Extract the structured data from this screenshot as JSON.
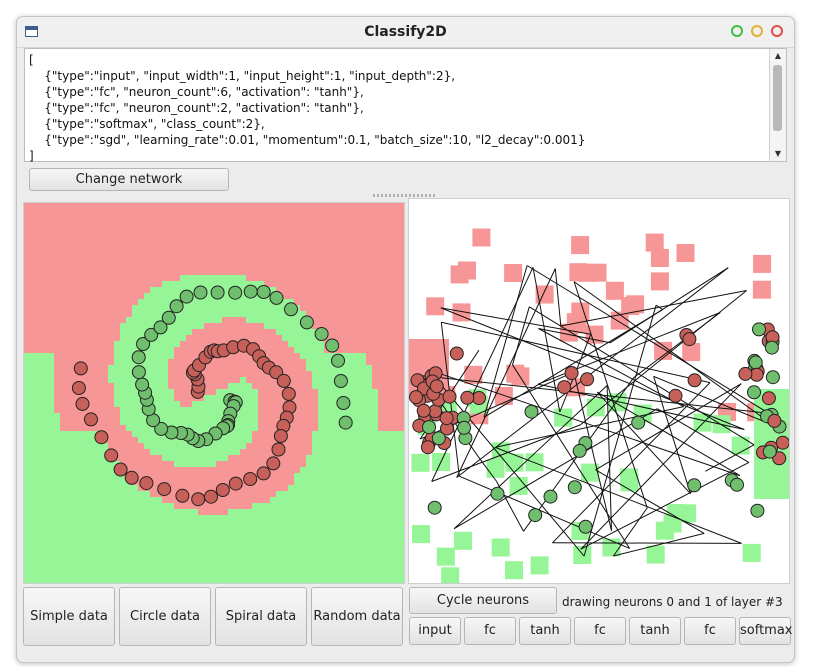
{
  "window": {
    "title": "Classify2D",
    "icon": "window-icon"
  },
  "editor": {
    "lines": [
      "[",
      "    {\"type\":\"input\", \"input_width\":1, \"input_height\":1, \"input_depth\":2},",
      "    {\"type\":\"fc\", \"neuron_count\":6, \"activation\": \"tanh\"},",
      "    {\"type\":\"fc\", \"neuron_count\":2, \"activation\": \"tanh\"},",
      "    {\"type\":\"softmax\", \"class_count\":2},",
      "    {\"type\":\"sgd\", \"learning_rate\":0.01, \"momentum\":0.1, \"batch_size\":10, \"l2_decay\":0.001}",
      "]"
    ]
  },
  "buttons": {
    "change_network": "Change network",
    "simple_data": "Simple data",
    "circle_data": "Circle data",
    "spiral_data": "Spiral data",
    "random_data": "Random data",
    "cycle_neurons": "Cycle neurons"
  },
  "status_text": "drawing neurons 0 and 1 of layer #3",
  "layer_buttons": [
    "input",
    "fc",
    "tanh",
    "fc",
    "tanh",
    "fc",
    "softmax"
  ],
  "colors": {
    "red_region": "#f79696",
    "green_region": "#96f596",
    "red_point": "#c8605a",
    "green_point": "#6fbf6f"
  }
}
